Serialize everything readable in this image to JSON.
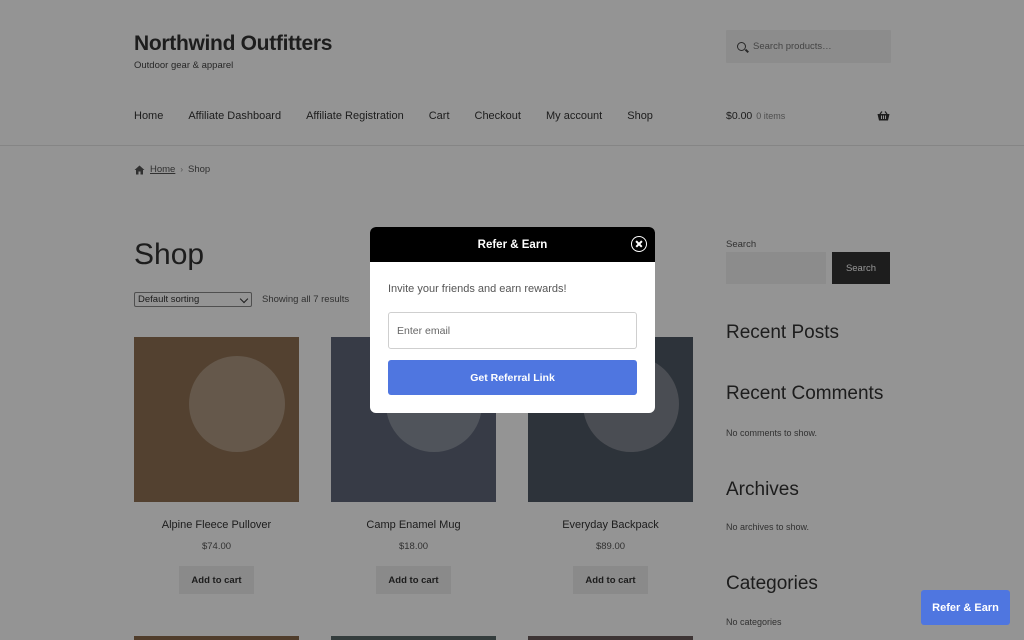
{
  "site": {
    "title": "Northwind Outfitters",
    "tagline": "Outdoor gear & apparel",
    "search_placeholder": "Search products…"
  },
  "nav": {
    "items": [
      "Home",
      "Affiliate Dashboard",
      "Affiliate Registration",
      "Cart",
      "Checkout",
      "My account",
      "Shop"
    ]
  },
  "cart": {
    "total": "$0.00",
    "items": "0 items"
  },
  "breadcrumb": {
    "home": "Home",
    "current": "Shop"
  },
  "shop": {
    "heading": "Shop",
    "sort_selected": "Default sorting",
    "results": "Showing all 7 results",
    "add_to_cart_label": "Add to cart",
    "products": [
      {
        "name": "Alpine Fleece Pullover",
        "price": "$74.00",
        "color": "#8f7153"
      },
      {
        "name": "Camp Enamel Mug",
        "price": "$18.00",
        "color": "#5f6779"
      },
      {
        "name": "Everyday Backpack",
        "price": "$89.00",
        "color": "#4f5864"
      }
    ],
    "row2_colors": [
      "#8a6a4a",
      "#5a6a6a",
      "#6a5a5a"
    ]
  },
  "sidebar": {
    "search_label": "Search",
    "search_button": "Search",
    "recent_posts": "Recent Posts",
    "recent_comments": "Recent Comments",
    "no_comments": "No comments to show.",
    "archives": "Archives",
    "no_archives": "No archives to show.",
    "categories": "Categories",
    "no_categories": "No categories"
  },
  "modal": {
    "title": "Refer & Earn",
    "subtitle": "Invite your friends and earn rewards!",
    "email_placeholder": "Enter email",
    "button": "Get Referral Link",
    "accent": "#4f76e0"
  },
  "floating_button": "Refer & Earn"
}
